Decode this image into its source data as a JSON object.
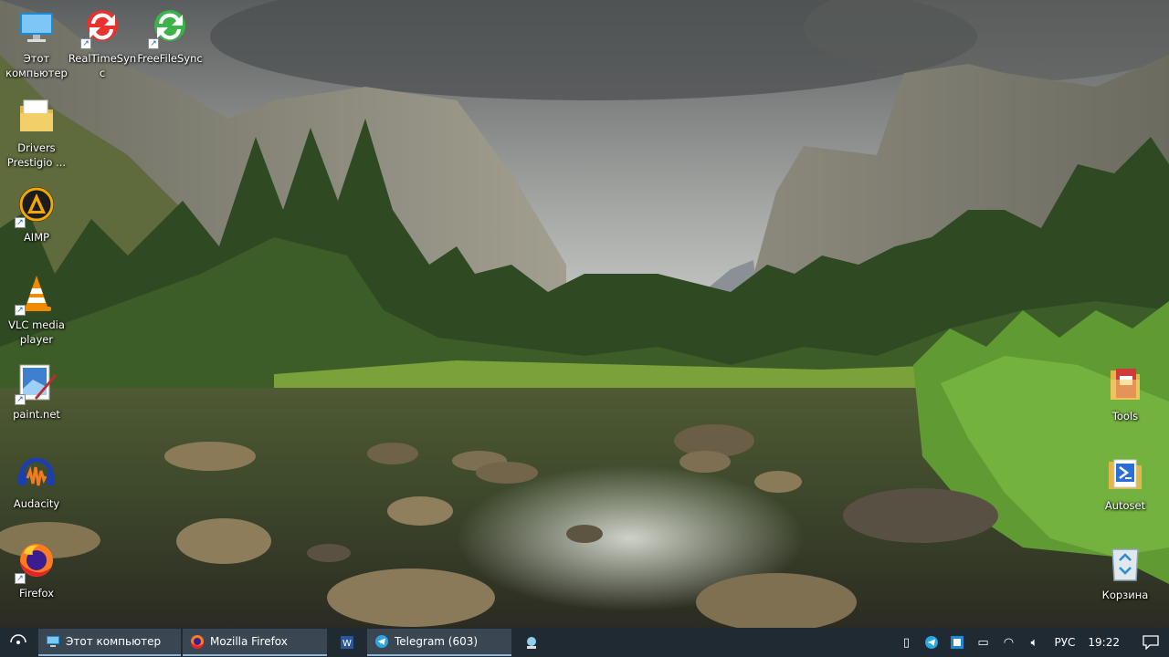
{
  "desktop": {
    "left_icons": [
      {
        "label": "Этот компьютер",
        "icon": "computer-icon"
      },
      {
        "label": "RealTimeSync",
        "icon": "realtimesync-icon"
      },
      {
        "label": "FreeFileSync",
        "icon": "freefilesync-icon"
      },
      {
        "label": "Drivers Prestigio ...",
        "icon": "folder-icon"
      },
      {
        "label": "AIMP",
        "icon": "aimp-icon"
      },
      {
        "label": "VLC media player",
        "icon": "vlc-icon"
      },
      {
        "label": "paint.net",
        "icon": "paintnet-icon"
      },
      {
        "label": "Audacity",
        "icon": "audacity-icon"
      },
      {
        "label": "Firefox",
        "icon": "firefox-icon"
      }
    ],
    "right_icons": [
      {
        "label": "Tools",
        "icon": "tools-folder-icon"
      },
      {
        "label": "Autoset",
        "icon": "powershell-icon"
      },
      {
        "label": "Корзина",
        "icon": "recycle-bin-icon"
      }
    ]
  },
  "taskbar": {
    "tasks": [
      {
        "label": "Этот компьютер",
        "icon": "computer-icon"
      },
      {
        "label": "Mozilla Firefox",
        "icon": "firefox-icon"
      },
      {
        "label": "",
        "icon": "word-icon"
      },
      {
        "label": "Telegram (603)",
        "icon": "telegram-icon"
      },
      {
        "label": "",
        "icon": "app-icon"
      }
    ],
    "tray": {
      "language": "РУС",
      "clock": "19:22"
    }
  },
  "colors": {
    "taskbar_bg": "#1f2a33",
    "task_active_bg": "#3a4752",
    "task_underline": "#8fb8d8"
  }
}
